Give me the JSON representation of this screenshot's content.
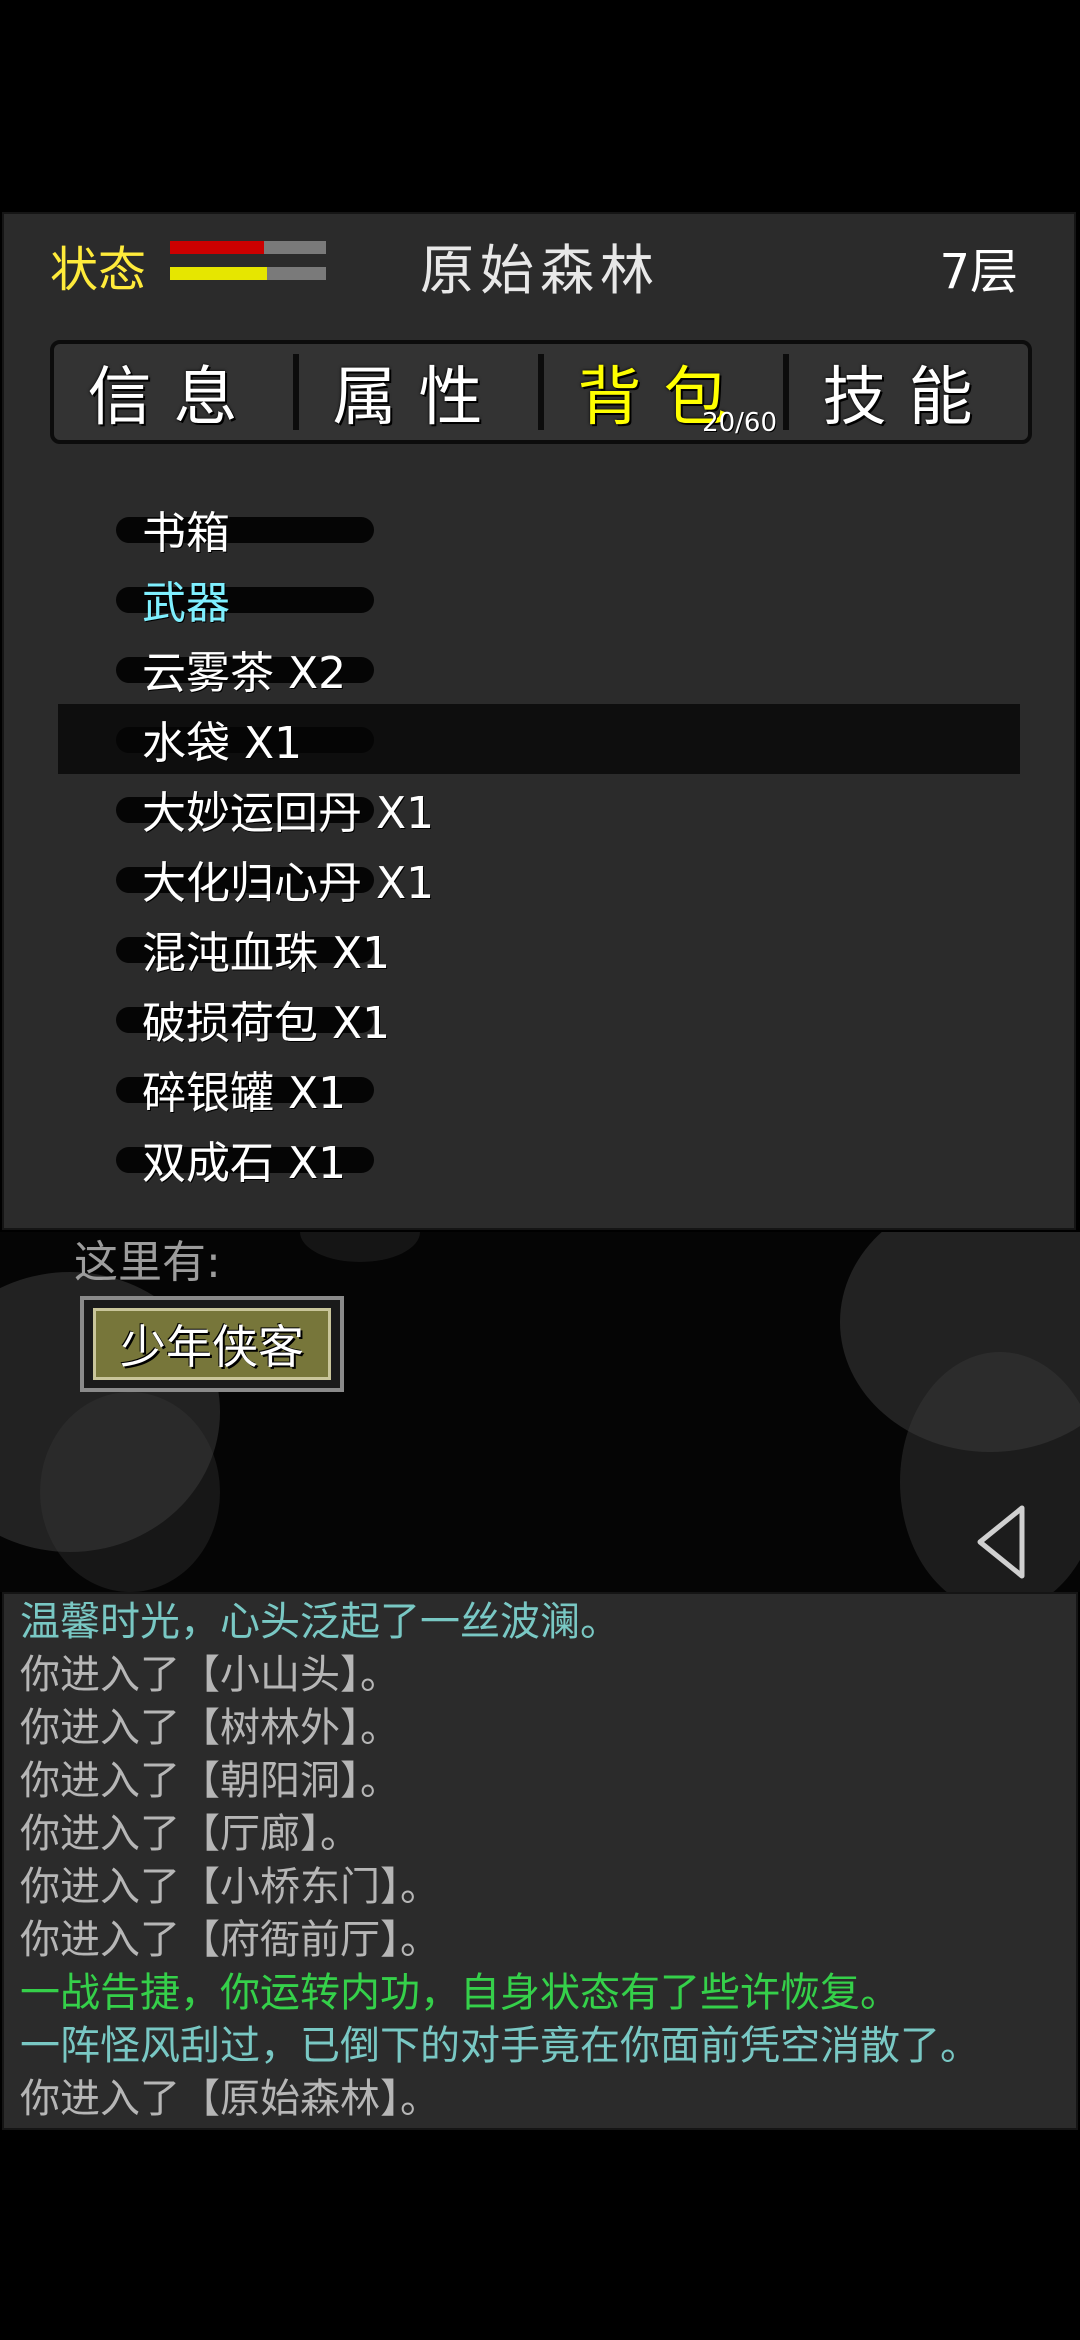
{
  "header": {
    "status_label": "状态",
    "hp_fraction": 0.6,
    "mp_fraction": 0.62,
    "location": "原始森林",
    "floor": "7层"
  },
  "tabs": [
    {
      "label": "信息",
      "active": false
    },
    {
      "label": "属性",
      "active": false
    },
    {
      "label": "背包",
      "active": true,
      "count": "20/60"
    },
    {
      "label": "技能",
      "active": false
    }
  ],
  "inventory": {
    "items": [
      {
        "label": "书箱"
      },
      {
        "label": "武器"
      },
      {
        "label": "云雾茶 X2"
      },
      {
        "label": "水袋 X1"
      },
      {
        "label": "大妙运回丹 X1"
      },
      {
        "label": "大化归心丹 X1"
      },
      {
        "label": "混沌血珠 X1"
      },
      {
        "label": "破损荷包 X1"
      },
      {
        "label": "碎银罐 X1"
      },
      {
        "label": "双成石 X1"
      }
    ]
  },
  "scene": {
    "here_label": "这里有:",
    "npc": "少年侠客"
  },
  "log": {
    "lines": [
      "温馨时光，心头泛起了一丝波澜。",
      "你进入了【小山头】。",
      "你进入了【树林外】。",
      "你进入了【朝阳洞】。",
      "你进入了【厅廊】。",
      "你进入了【小桥东门】。",
      "你进入了【府衙前厅】。",
      "一战告捷，你运转内功，自身状态有了些许恢复。",
      "一阵怪风刮过，已倒下的对手竟在你面前凭空消散了。",
      "你进入了【原始森林】。"
    ]
  },
  "colors": {
    "hp": "#cc0000",
    "mp": "#e6e600",
    "active_tab": "#ffff00",
    "weapon_item": "#7ff0ff",
    "log_default": "#b6b6b6",
    "log_cyan": "#79c8c4",
    "log_green": "#35d04a"
  }
}
